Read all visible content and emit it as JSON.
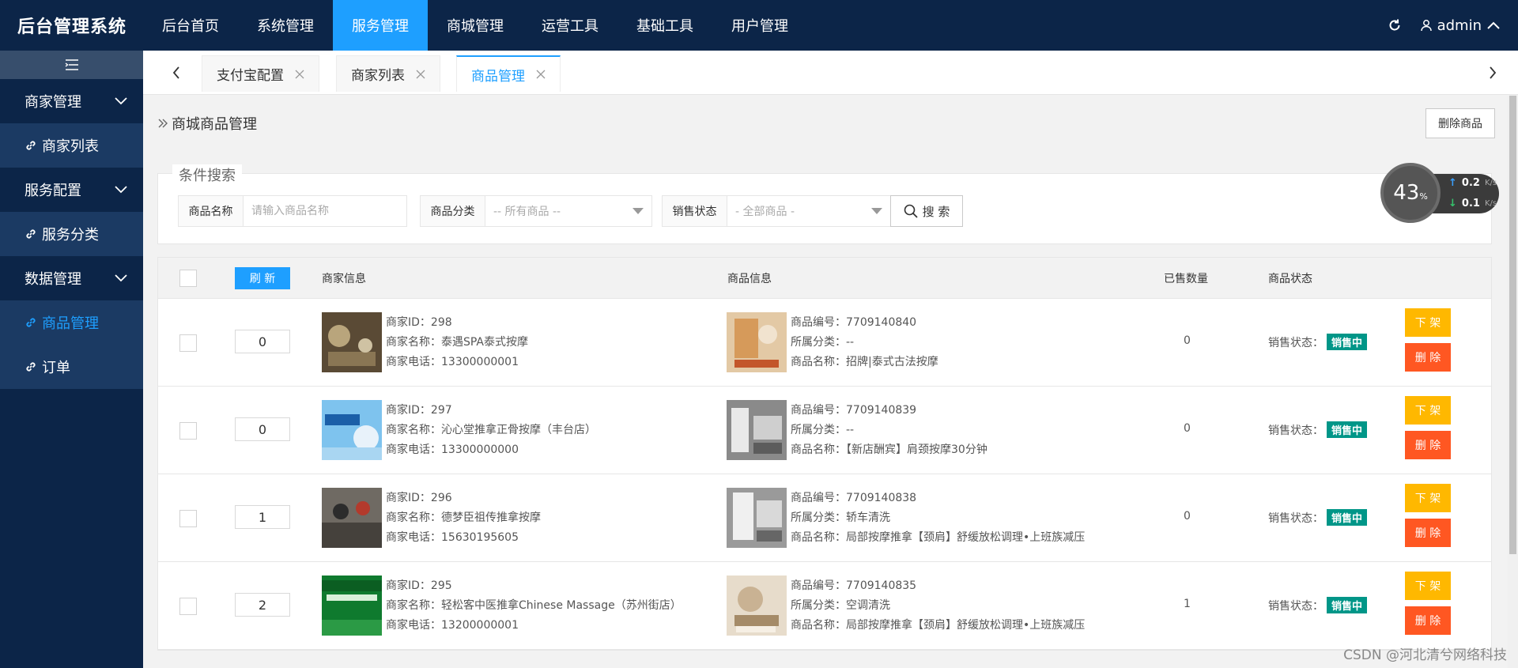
{
  "app": {
    "title": "后台管理系统"
  },
  "topnav": [
    {
      "label": "后台首页",
      "active": false
    },
    {
      "label": "系统管理",
      "active": false
    },
    {
      "label": "服务管理",
      "active": true
    },
    {
      "label": "商城管理",
      "active": false
    },
    {
      "label": "运营工具",
      "active": false
    },
    {
      "label": "基础工具",
      "active": false
    },
    {
      "label": "用户管理",
      "active": false
    }
  ],
  "user": {
    "name": "admin"
  },
  "sidebar": {
    "items": [
      {
        "type": "group",
        "label": "商家管理"
      },
      {
        "type": "sub",
        "label": "商家列表"
      },
      {
        "type": "group",
        "label": "服务配置"
      },
      {
        "type": "sub",
        "label": "服务分类"
      },
      {
        "type": "group",
        "label": "数据管理"
      },
      {
        "type": "sub",
        "label": "商品管理"
      },
      {
        "type": "sub",
        "label": "订单"
      }
    ]
  },
  "tabs": [
    {
      "label": "支付宝配置"
    },
    {
      "label": "商家列表"
    },
    {
      "label": "商品管理"
    }
  ],
  "page": {
    "breadcrumb": "商城商品管理",
    "delete_goods": "删除商品"
  },
  "search": {
    "legend": "条件搜索",
    "name_label": "商品名称",
    "name_placeholder": "请输入商品名称",
    "category_label": "商品分类",
    "category_value": "-- 所有商品 --",
    "status_label": "销售状态",
    "status_value": "- 全部商品 -",
    "button": "搜 索"
  },
  "speed": {
    "percent": "43",
    "percent_unit": "%",
    "up": "0.2",
    "down": "0.1",
    "unit": "K/s"
  },
  "table": {
    "refresh": "刷 新",
    "headers": {
      "merchant": "商家信息",
      "goods": "商品信息",
      "sold": "已售数量",
      "status": "商品状态"
    },
    "labels": {
      "merchant_id": "商家ID：",
      "merchant_name": "商家名称：",
      "merchant_phone": "商家电话：",
      "goods_no": "商品编号：",
      "goods_cat": "所属分类：",
      "goods_name": "商品名称：",
      "sale_status": "销售状态：",
      "off_shelf": "下 架",
      "delete": "删 除"
    },
    "rows": [
      {
        "sort": "0",
        "merchant_id": "298",
        "merchant_name": "泰遇SPA泰式按摩",
        "merchant_phone": "13300000001",
        "goods_no": "7709140840",
        "goods_cat": "--",
        "goods_name": "招牌|泰式古法按摩",
        "sold": "0",
        "status": "销售中"
      },
      {
        "sort": "0",
        "merchant_id": "297",
        "merchant_name": "沁心堂推拿正骨按摩（丰台店）",
        "merchant_phone": "13300000000",
        "goods_no": "7709140839",
        "goods_cat": "--",
        "goods_name": "【新店酬宾】肩颈按摩30分钟",
        "sold": "0",
        "status": "销售中"
      },
      {
        "sort": "1",
        "merchant_id": "296",
        "merchant_name": "德梦臣祖传推拿按摩",
        "merchant_phone": "15630195605",
        "goods_no": "7709140838",
        "goods_cat": "轿车清洗",
        "goods_name": "局部按摩推拿【颈肩】舒缓放松调理•上班族减压",
        "sold": "0",
        "status": "销售中"
      },
      {
        "sort": "2",
        "merchant_id": "295",
        "merchant_name": "轻松客中医推拿Chinese Massage（苏州街店）",
        "merchant_phone": "13200000001",
        "goods_no": "7709140835",
        "goods_cat": "空调清洗",
        "goods_name": "局部按摩推拿【颈肩】舒缓放松调理•上班族减压",
        "sold": "1",
        "status": "销售中"
      }
    ]
  },
  "watermark": "CSDN @河北清兮网络科技",
  "colors": {
    "header": "#0c2548",
    "accent": "#1e9fff",
    "badge": "#009688",
    "offshelf": "#ffb800",
    "danger": "#ff5722"
  }
}
